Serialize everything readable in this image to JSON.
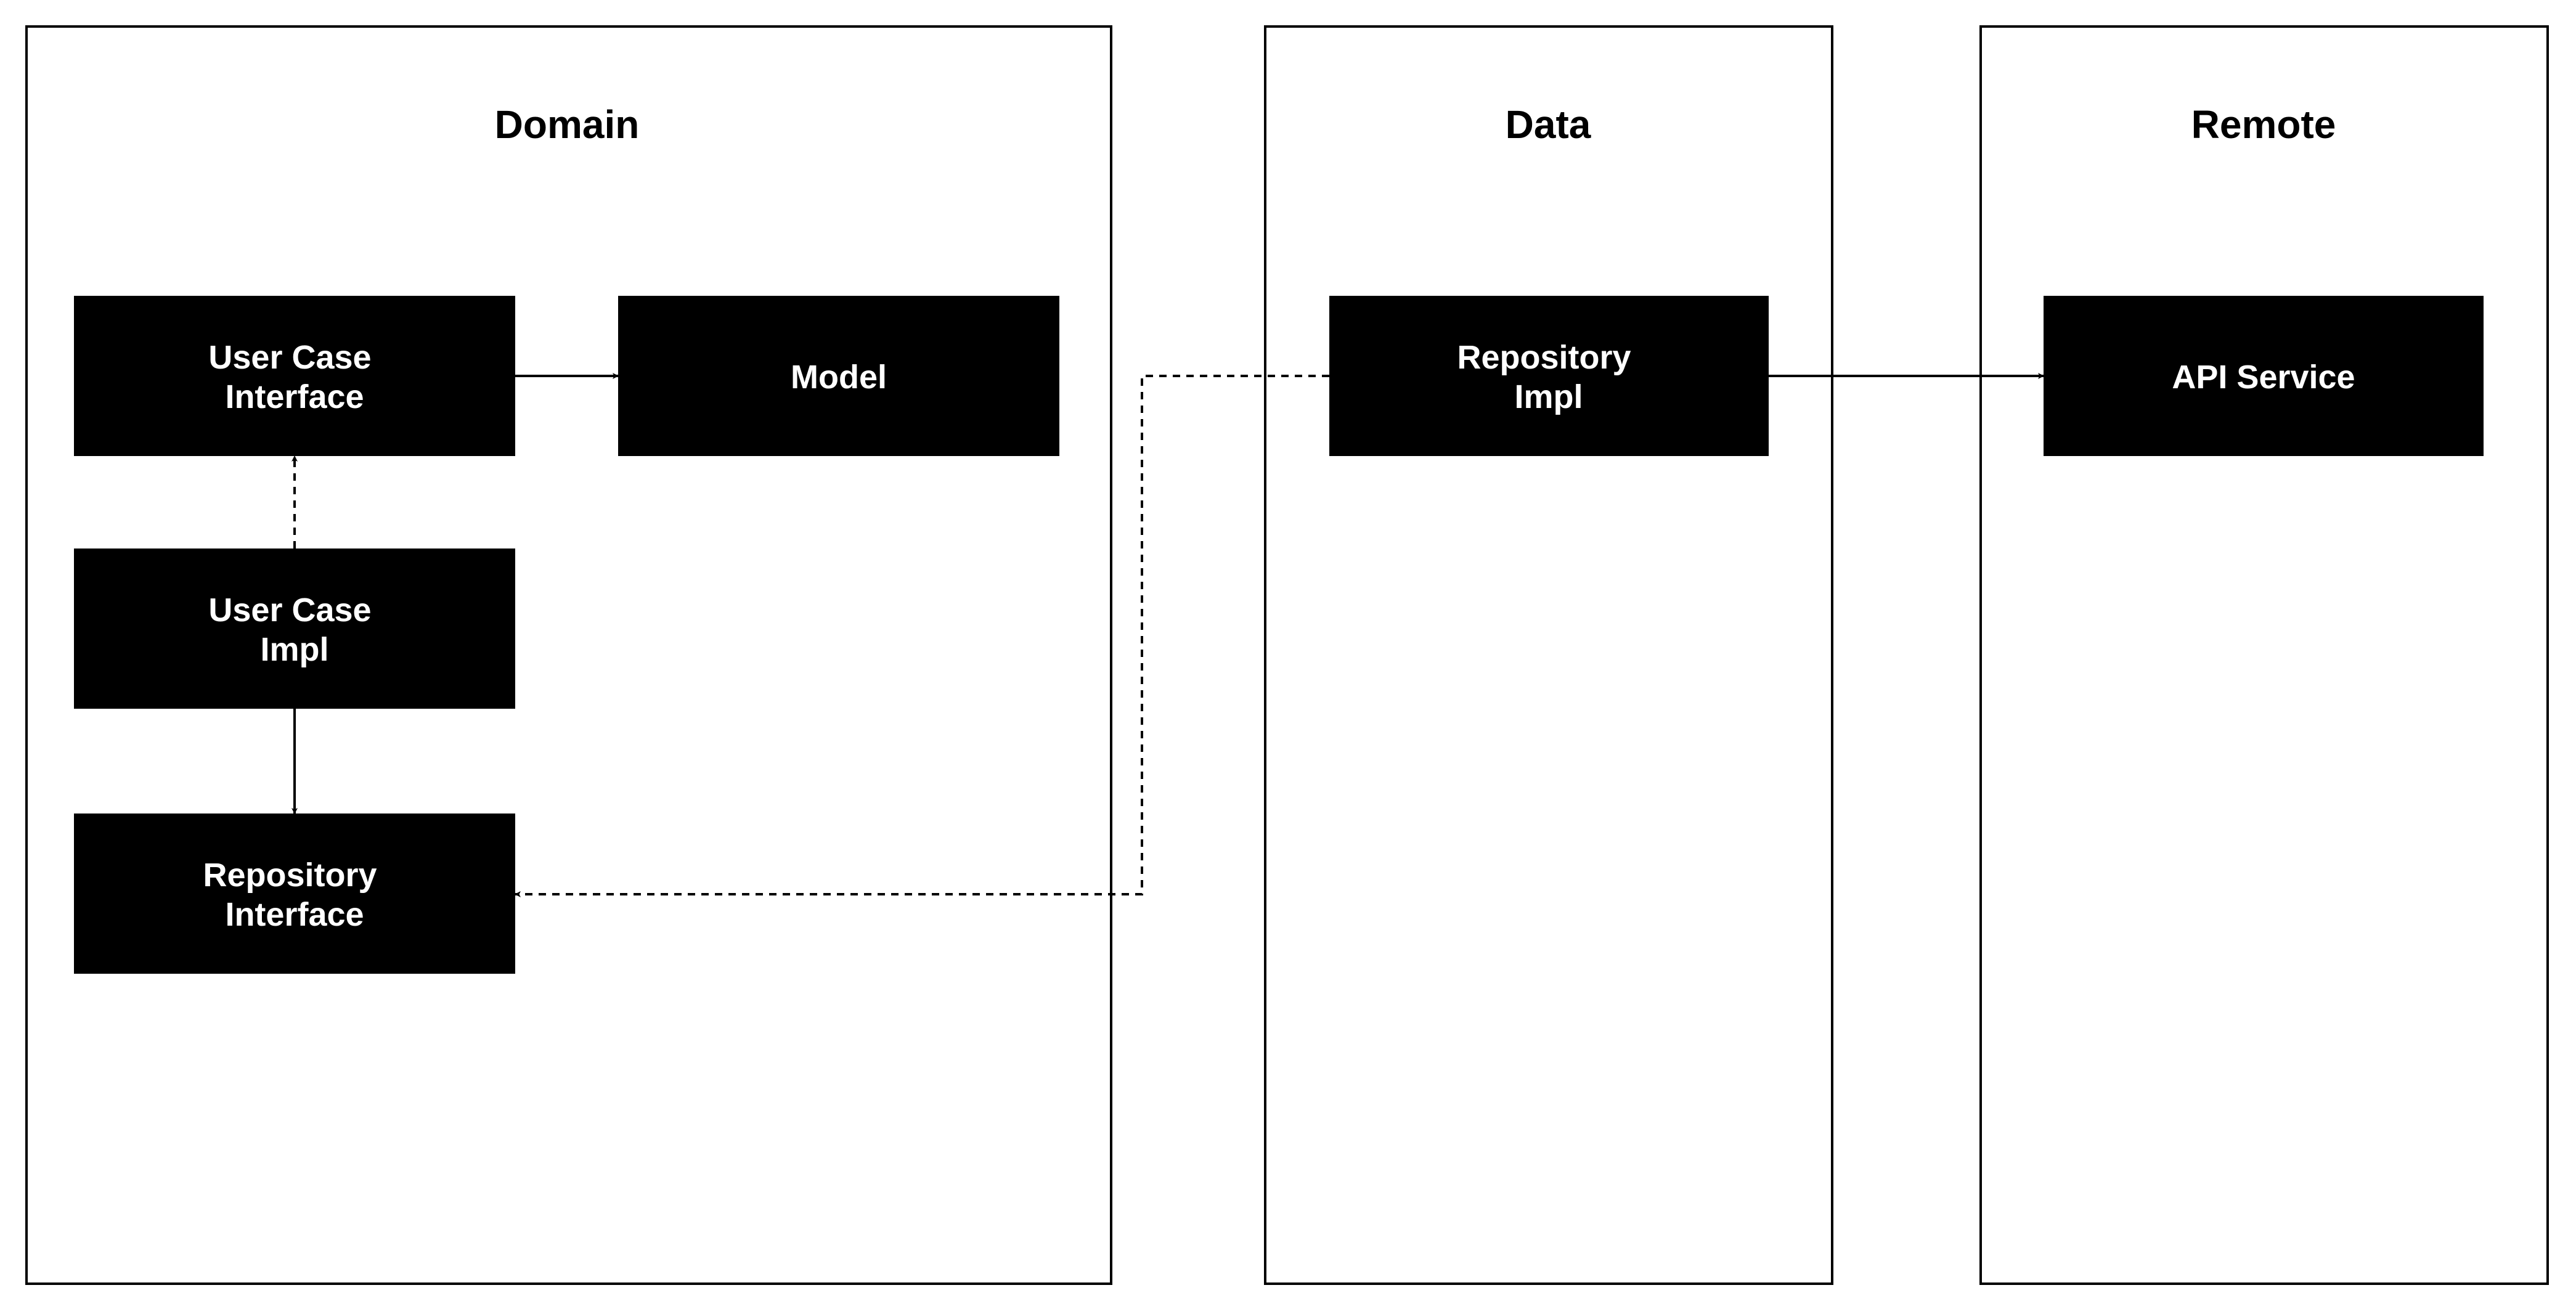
{
  "containers": {
    "domain": {
      "title": "Domain"
    },
    "data": {
      "title": "Data"
    },
    "remote": {
      "title": "Remote"
    }
  },
  "nodes": {
    "use_case_interface": {
      "line1": "User Case",
      "line2": "Interface"
    },
    "model": {
      "line1": "Model"
    },
    "use_case_impl": {
      "line1": "User Case",
      "line2": "Impl"
    },
    "repository_interface": {
      "line1": "Repository",
      "line2": "Interface"
    },
    "repository_impl": {
      "line1": "Repository",
      "line2": "Impl"
    },
    "api_service": {
      "line1": "API Service"
    }
  },
  "edges": [
    {
      "from": "use_case_interface",
      "to": "model",
      "style": "solid"
    },
    {
      "from": "use_case_impl",
      "to": "use_case_interface",
      "style": "dashed"
    },
    {
      "from": "use_case_impl",
      "to": "repository_interface",
      "style": "solid"
    },
    {
      "from": "repository_impl",
      "to": "repository_interface",
      "style": "dashed"
    },
    {
      "from": "repository_impl",
      "to": "api_service",
      "style": "solid"
    }
  ],
  "colors": {
    "node_fill": "#000000",
    "node_text": "#ffffff",
    "container_stroke": "#000000",
    "edge": "#000000",
    "background": "#ffffff"
  }
}
